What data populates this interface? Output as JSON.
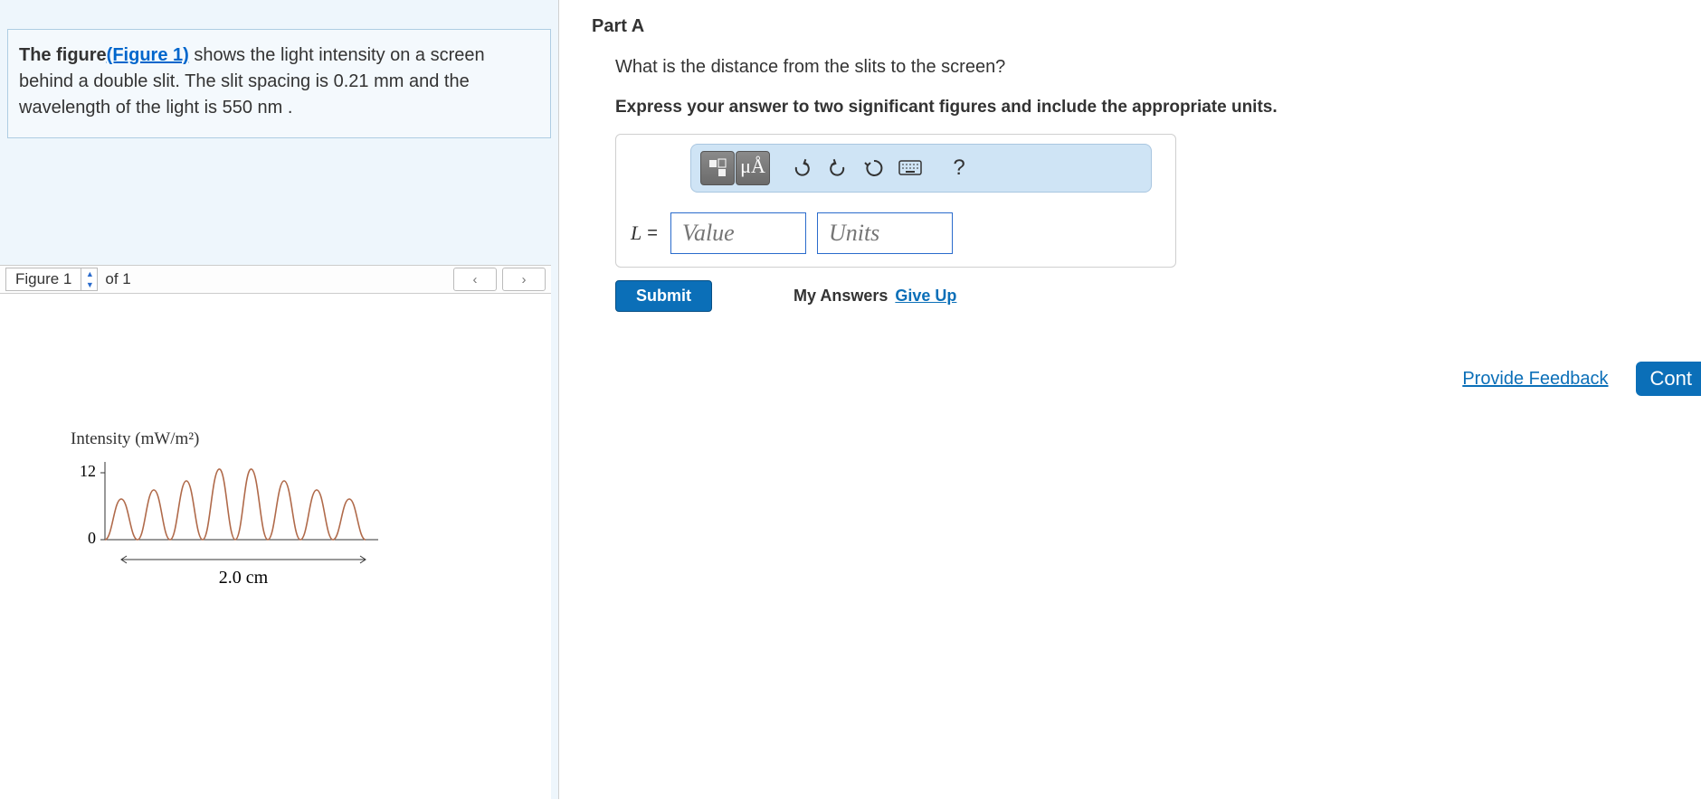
{
  "problem": {
    "text_pre": "The figure",
    "fig_link": "(Figure 1)",
    "text_post": " shows the light intensity on a screen behind a double slit. The slit spacing is 0.21 mm and the wavelength of the light is 550 nm ."
  },
  "figure_selector": {
    "current": "Figure 1",
    "of_label": "of 1"
  },
  "chart_data": {
    "type": "line",
    "title": "Intensity (mW/m²)",
    "ylabel": "",
    "ytick_labels": [
      "0",
      "12"
    ],
    "ylim": [
      0,
      12
    ],
    "x_span_label": "2.0 cm",
    "series": [
      {
        "name": "intensity",
        "x": [
          -1.0,
          -0.95,
          -0.9,
          -0.85,
          -0.8,
          -0.75,
          -0.7,
          -0.65,
          -0.6,
          -0.55,
          -0.5,
          -0.45,
          -0.4,
          -0.35,
          -0.3,
          -0.25,
          -0.2,
          -0.15,
          -0.1,
          -0.05,
          0.0,
          0.05,
          0.1,
          0.15,
          0.2,
          0.25,
          0.3,
          0.35,
          0.4,
          0.45,
          0.5,
          0.55,
          0.6,
          0.65,
          0.7,
          0.75,
          0.8,
          0.85,
          0.9,
          0.95,
          1.0
        ],
        "values": [
          0,
          3,
          8,
          7,
          2,
          0,
          3,
          9,
          8,
          3,
          0,
          3,
          10,
          9,
          3,
          0,
          4,
          11,
          10,
          4,
          0,
          4,
          10,
          11,
          4,
          0,
          3,
          9,
          10,
          3,
          0,
          3,
          8,
          9,
          3,
          0,
          2,
          7,
          8,
          3,
          0
        ]
      }
    ],
    "peaks_approx_cm": [
      -0.9,
      -0.65,
      -0.4,
      -0.15,
      0.15,
      0.4,
      0.65,
      0.9
    ],
    "peak_max_value": 12,
    "fringe_spacing_cm": 0.25
  },
  "partA": {
    "header": "Part A",
    "question": "What is the distance from the slits to the screen?",
    "instruction": "Express your answer to two significant figures and include the appropriate units.",
    "toolbar": {
      "units_label": "μÅ",
      "help_label": "?"
    },
    "variable": "L",
    "equals": "=",
    "value_placeholder": "Value",
    "units_placeholder": "Units",
    "submit": "Submit",
    "my_answers": "My Answers",
    "give_up": "Give Up"
  },
  "footer": {
    "provide_feedback": "Provide Feedback",
    "continue": "Cont"
  }
}
